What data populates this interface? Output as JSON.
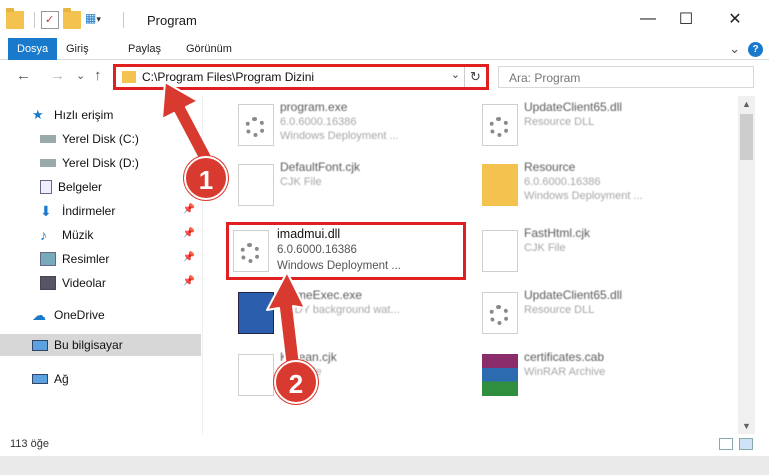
{
  "window": {
    "title": "Program",
    "minimize_glyph": "—",
    "maximize_glyph": "☐",
    "close_glyph": "✕"
  },
  "ribbon": {
    "tabs": [
      {
        "label": "Dosya",
        "active": true
      },
      {
        "label": "Giriş"
      },
      {
        "label": "Paylaş"
      },
      {
        "label": "Görünüm"
      }
    ],
    "expand_glyph": "⌄",
    "help_glyph": "?"
  },
  "nav": {
    "back_glyph": "←",
    "forward_glyph": "→",
    "recent_glyph": "⌄",
    "up_glyph": "↑"
  },
  "address": {
    "path": "C:\\Program Files\\Program Dizini",
    "dropdown_glyph": "⌄",
    "refresh_glyph": "↻"
  },
  "search": {
    "placeholder": "Ara: Program",
    "icon": "search-icon"
  },
  "sidebar": {
    "items": [
      {
        "label": "Hızlı erişim",
        "icon": "star-icon"
      },
      {
        "label": "Yerel Disk (C:)",
        "icon": "drive-icon"
      },
      {
        "label": "Yerel Disk (D:)",
        "icon": "drive-icon"
      },
      {
        "label": "Belgeler",
        "icon": "documents-icon"
      },
      {
        "label": "İndirmeler",
        "icon": "download-icon"
      },
      {
        "label": "Müzik",
        "icon": "music-icon"
      },
      {
        "label": "Resimler",
        "icon": "pictures-icon"
      },
      {
        "label": "Videolar",
        "icon": "videos-icon"
      },
      {
        "label": "OneDrive",
        "icon": "cloud-icon"
      },
      {
        "label": "Bu bilgisayar",
        "icon": "computer-icon",
        "selected": true
      },
      {
        "label": "Ağ",
        "icon": "network-icon"
      }
    ]
  },
  "files": {
    "program_exe": {
      "name": "program.exe",
      "line2": "6.0.6000.16386",
      "line3": "Windows Deployment ..."
    },
    "update1": {
      "name": "UpdateClient65.dll",
      "line2": "Resource DLL"
    },
    "defaultfont": {
      "name": "DefaultFont.cjk",
      "line2": "CJK File"
    },
    "resource": {
      "name": "Resource",
      "line2": "6.0.6000.16386",
      "line3": "Windows Deployment ..."
    },
    "imadmui": {
      "name": "imadmui.dll",
      "line2": "6.0.6000.16386",
      "line3": "Windows Deployment ..."
    },
    "fasthtml": {
      "name": "FastHtml.cjk",
      "line2": "CJK File"
    },
    "gameexec": {
      "name": "GameExec.exe",
      "line2": "EBDY background wat..."
    },
    "update2": {
      "name": "UpdateClient65.dll",
      "line2": "Resource DLL"
    },
    "korean": {
      "name": "Korean.cjk",
      "line2": "CJK File"
    },
    "certificates": {
      "name": "certificates.cab",
      "line2": "WinRAR Archive"
    }
  },
  "status": {
    "count": "113 öğe"
  },
  "annotations": {
    "step1": "1",
    "step2": "2",
    "color": "#d93a2f"
  }
}
